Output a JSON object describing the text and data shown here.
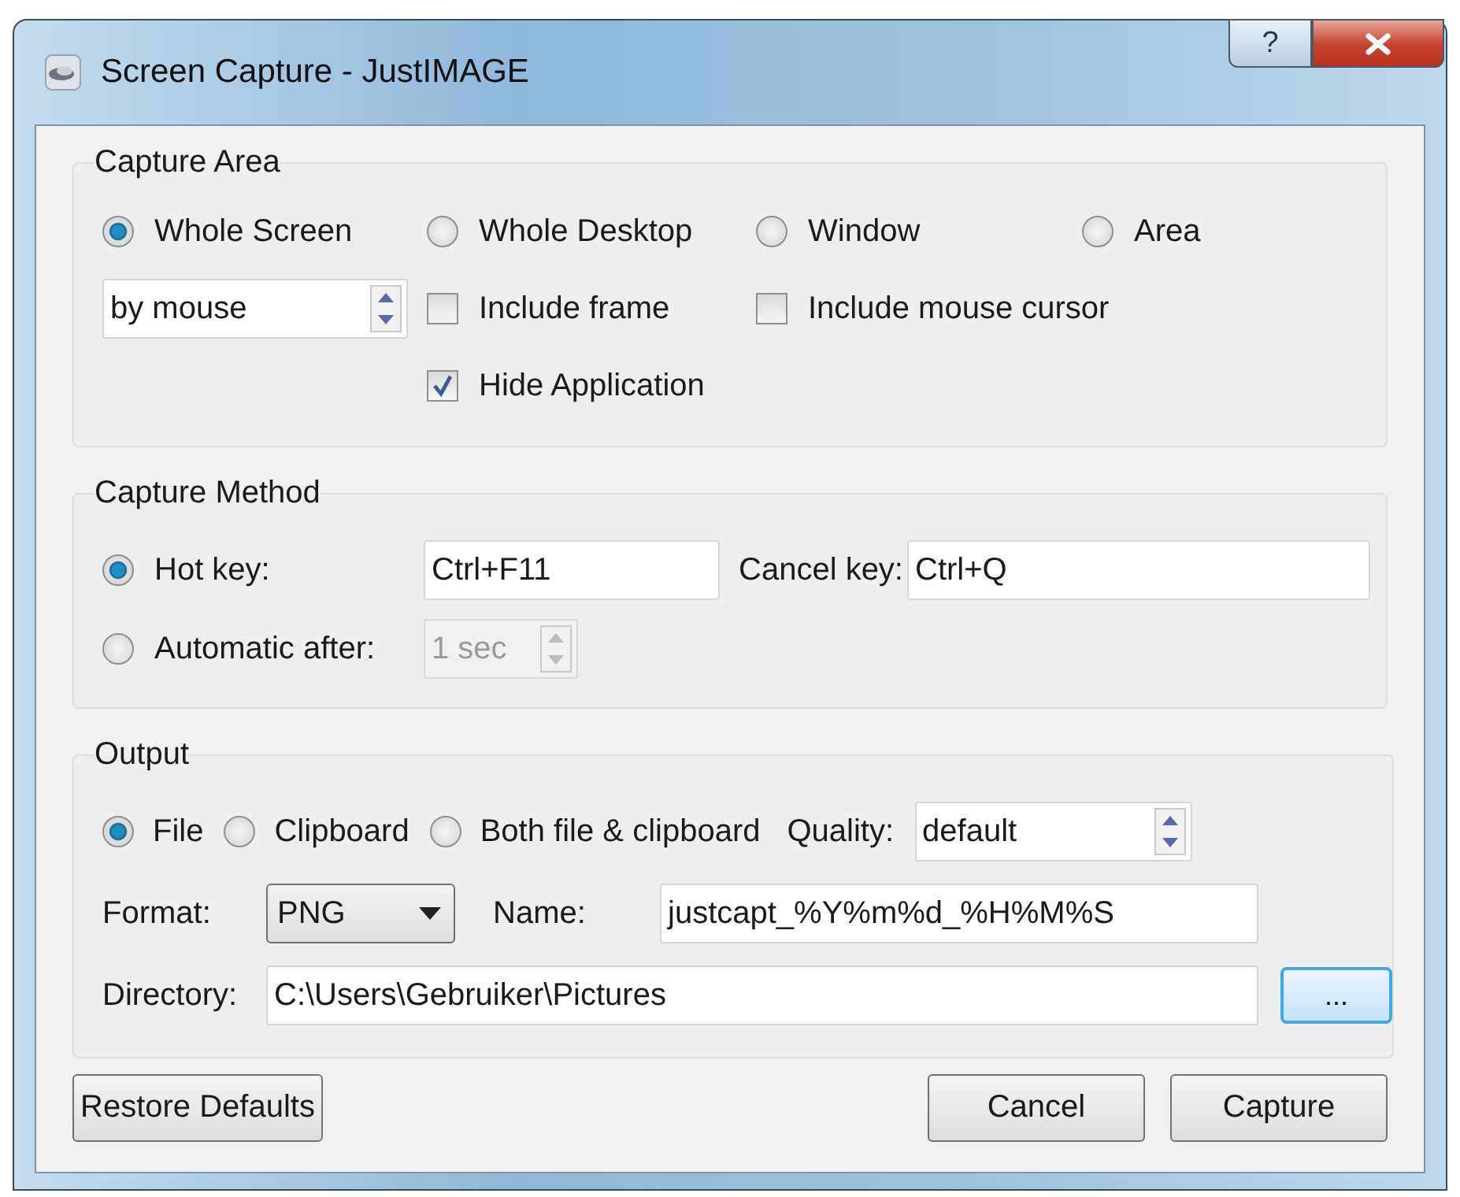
{
  "window": {
    "title": "Screen Capture - JustIMAGE",
    "help_button": "?"
  },
  "capture_area": {
    "title": "Capture Area",
    "modes": [
      {
        "label": "Whole Screen",
        "selected": true
      },
      {
        "label": "Whole Desktop",
        "selected": false
      },
      {
        "label": "Window",
        "selected": false
      },
      {
        "label": "Area",
        "selected": false
      }
    ],
    "selection_mode": {
      "value": "by mouse"
    },
    "options": [
      {
        "label": "Include frame",
        "checked": false
      },
      {
        "label": "Include mouse cursor",
        "checked": false
      },
      {
        "label": "Hide Application",
        "checked": true
      }
    ]
  },
  "capture_method": {
    "title": "Capture Method",
    "methods": [
      {
        "label": "Hot key:",
        "selected": true
      },
      {
        "label": "Automatic after:",
        "selected": false
      }
    ],
    "hot_key": {
      "value": "Ctrl+F11"
    },
    "cancel_key": {
      "label": "Cancel key:",
      "value": "Ctrl+Q"
    },
    "delay": {
      "value": "1 sec",
      "disabled": true
    }
  },
  "output": {
    "title": "Output",
    "destinations": [
      {
        "label": "File",
        "selected": true
      },
      {
        "label": "Clipboard",
        "selected": false
      },
      {
        "label": "Both file & clipboard",
        "selected": false
      }
    ],
    "quality": {
      "label": "Quality:",
      "value": "default"
    },
    "format": {
      "label": "Format:",
      "value": "PNG"
    },
    "name": {
      "label": "Name:",
      "value": "justcapt_%Y%m%d_%H%M%S"
    },
    "directory": {
      "label": "Directory:",
      "value": "C:\\Users\\Gebruiker\\Pictures"
    },
    "browse_button": "..."
  },
  "buttons": {
    "restore": "Restore Defaults",
    "cancel": "Cancel",
    "capture": "Capture"
  }
}
